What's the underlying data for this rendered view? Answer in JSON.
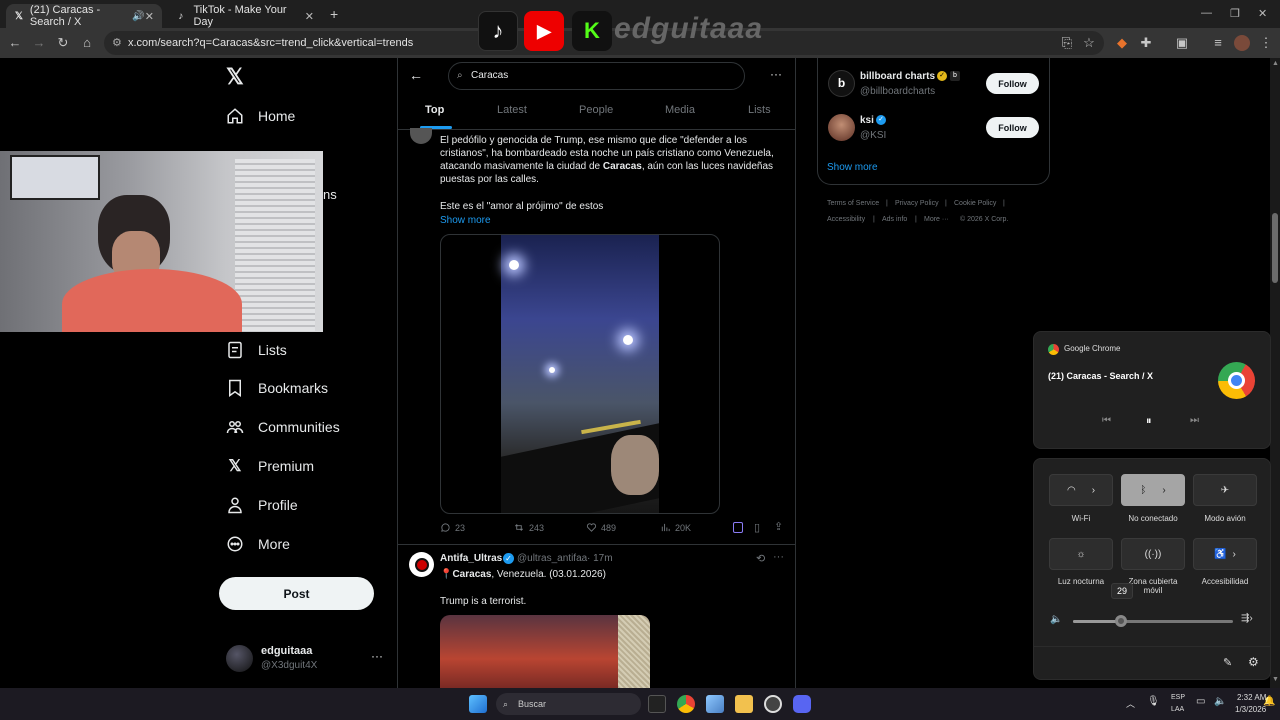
{
  "browser": {
    "tabs": [
      {
        "title": "(21) Caracas - Search / X",
        "favicon": "x-logo"
      },
      {
        "title": "TikTok - Make Your Day",
        "favicon": "tiktok-logo"
      }
    ],
    "url": "x.com/search?q=Caracas&src=trend_click&vertical=trends"
  },
  "overlay": {
    "streamer_name": "edguitaaa"
  },
  "x_nav": {
    "items": [
      {
        "label": "Home",
        "icon": "home-icon"
      },
      {
        "label": "Lists",
        "icon": "list-icon"
      },
      {
        "label": "Bookmarks",
        "icon": "bookmark-icon"
      },
      {
        "label": "Communities",
        "icon": "communities-icon"
      },
      {
        "label": "Premium",
        "icon": "x-logo-icon"
      },
      {
        "label": "Profile",
        "icon": "person-icon"
      },
      {
        "label": "More",
        "icon": "more-circle-icon"
      }
    ],
    "hidden_fragment": "ns",
    "post_label": "Post",
    "account": {
      "name": "edguitaaa",
      "handle": "@X3dguit4X"
    }
  },
  "search": {
    "query": "Caracas",
    "tabs": [
      "Top",
      "Latest",
      "People",
      "Media",
      "Lists"
    ],
    "active_tab": "Top"
  },
  "tweet1": {
    "text_line1": "El pedófilo y genocida de Trump, ese mismo que dice \"defender a los",
    "text_line2": "cristianos\", ha bombardeado esta noche un país cristiano como Venezuela,",
    "text_line3_pre": "atacando masivamente la ciudad de ",
    "text_line3_bold": "Caracas",
    "text_line3_post": ", aún con las luces navideñas",
    "text_line4": "puestas por las calles.",
    "text_line5": "Este es el \"amor al prójimo\" de estos",
    "show_more": "Show more",
    "replies": "23",
    "reposts": "243",
    "likes": "489",
    "views": "20K"
  },
  "tweet2": {
    "name": "Antifa_Ultras",
    "handle": "@ultras_antifaa",
    "time": "· 17m",
    "line1_bold": "Caracas",
    "line1_rest": ", Venezuela. (03.01.2026)",
    "line2": "Trump is a terrorist."
  },
  "who_to_follow": [
    {
      "name": "billboard charts",
      "handle": "@billboardcharts",
      "button": "Follow"
    },
    {
      "name": "ksi",
      "handle": "@KSI",
      "button": "Follow"
    }
  ],
  "show_more": "Show more",
  "footer": {
    "links": [
      "Terms of Service",
      "Privacy Policy",
      "Cookie Policy",
      "Accessibility",
      "Ads info",
      "More ···",
      "© 2026 X Corp."
    ]
  },
  "media_panel": {
    "app": "Google Chrome",
    "title": "(21) Caracas - Search / X"
  },
  "quick_settings": {
    "wifi": "Wi-Fi",
    "bluetooth": "No conectado",
    "airplane": "Modo avión",
    "night_light": "Luz nocturna",
    "hotspot": "Zona cubierta móvil",
    "accessibility": "Accesibilidad",
    "volume": "29",
    "volume_level": 0.3
  },
  "taskbar": {
    "search_placeholder": "Buscar",
    "lang": "ESP",
    "lang2": "LAA",
    "time": "2:32 AM",
    "date": "1/3/2026"
  }
}
